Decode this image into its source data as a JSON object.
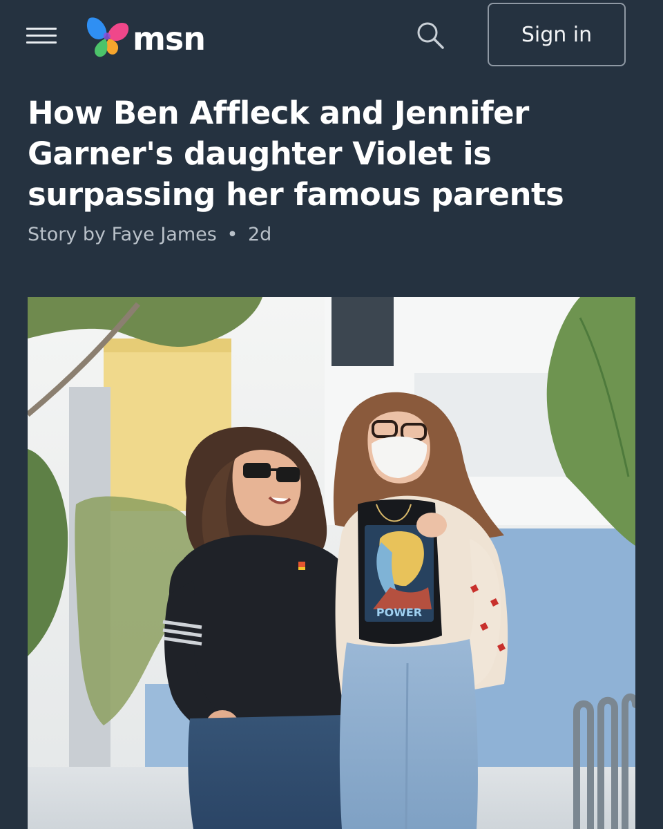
{
  "header": {
    "brand": "msn",
    "sign_in_label": "Sign in",
    "menu_icon": "hamburger-menu-icon",
    "search_icon": "search-icon"
  },
  "article": {
    "headline": "How Ben Affleck and Jennifer Garner's daughter Violet is surpassing her famous parents",
    "byline_author": "Story by Faye James",
    "byline_separator": "•",
    "byline_age": "2d"
  },
  "hero": {
    "shirt_text": "POWER"
  },
  "colors": {
    "background": "#253240",
    "text": "#ffffff",
    "byline": "#b9c1c9",
    "button_border": "#8f99a4",
    "logo_blue": "#2f8ff3",
    "logo_pink": "#f0478a",
    "logo_orange": "#f6a52d",
    "logo_green": "#4cc36a"
  }
}
